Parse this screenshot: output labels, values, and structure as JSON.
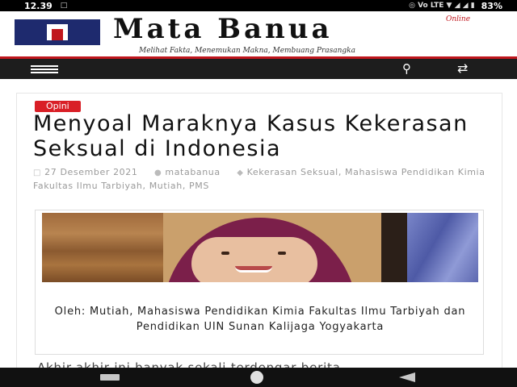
{
  "status_bar": {
    "time": "12.39",
    "battery": "83%",
    "left_glyphs": "□",
    "right_glyphs": "◎ Vo LTE ▼ ◢ ◢ ▮"
  },
  "header": {
    "site_name": "Mata Banua",
    "online_label": "Online",
    "tagline": "Melihat Fakta, Menemukan Makna, Membuang Prasangka"
  },
  "nav": {
    "menu_icon": "hamburger-menu-icon",
    "search_icon": "search-icon",
    "shuffle_icon": "shuffle-icon"
  },
  "article": {
    "category": "Opini",
    "title": "Menyoal Maraknya Kasus Kekerasan Seksual di Indonesia",
    "date": "27 Desember 2021",
    "author": "matabanua",
    "tags": "Kekerasan Seksual, Mahasiswa Pendidikan Kimia Fakultas Ilmu Tarbiyah, Mutiah, PMS",
    "image_caption": "Oleh: Mutiah, Mahasiswa Pendidikan Kimia Fakultas Ilmu Tarbiyah dan Pendidikan UIN Sunan Kalijaga Yogyakarta",
    "body_start": "Akhir-akhir ini banyak sekali terdengar berita"
  },
  "colors": {
    "accent_red": "#d91f26",
    "logo_blue": "#1e2a6e",
    "nav_dark": "#1d1d1d"
  }
}
